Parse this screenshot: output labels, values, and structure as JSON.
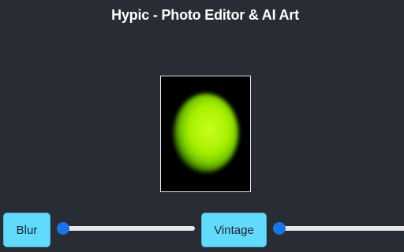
{
  "app": {
    "title": "Hypic - Photo Editor & AI Art"
  },
  "preview": {
    "background_color": "#000000",
    "border_color": "#e6e6e6",
    "shape": "glowing-ellipse",
    "shape_color": "#a8f000"
  },
  "controls": {
    "blur": {
      "label": "Blur",
      "slider_value_fraction": 0.0
    },
    "vintage": {
      "label": "Vintage",
      "slider_value_fraction": 0.0
    }
  },
  "colors": {
    "background": "#282c34",
    "title_text": "#ffffff",
    "button_fill": "#61dafb",
    "slider_track": "#e8e8e8",
    "slider_thumb": "#1a73e8"
  }
}
